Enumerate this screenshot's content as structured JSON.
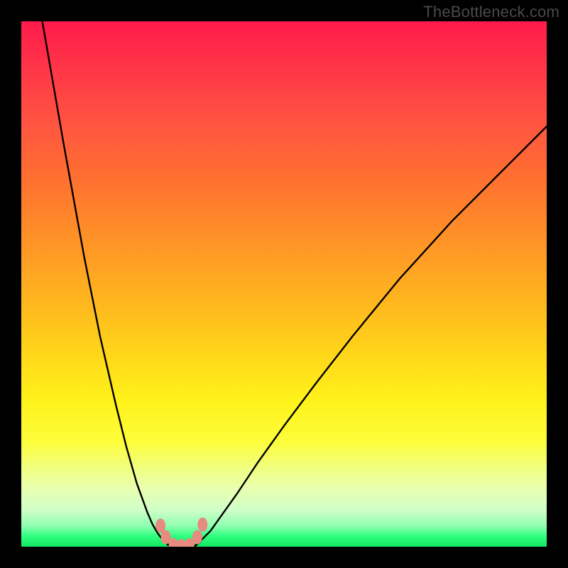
{
  "watermark": "TheBottleneck.com",
  "chart_data": {
    "type": "line",
    "title": "",
    "xlabel": "",
    "ylabel": "",
    "xlim": [
      0,
      100
    ],
    "ylim": [
      0,
      100
    ],
    "background_gradient_meaning": "red high to green low",
    "series": [
      {
        "name": "curve-left",
        "x": [
          4,
          8,
          12,
          15,
          18,
          20,
          22,
          24,
          25,
          26,
          27,
          28,
          29
        ],
        "y": [
          100,
          77,
          55,
          40,
          27,
          19,
          12,
          6.5,
          4.2,
          2.5,
          1.2,
          0.4,
          0
        ]
      },
      {
        "name": "curve-right",
        "x": [
          33,
          34,
          36,
          38,
          41,
          45,
          50,
          56,
          63,
          72,
          82,
          92,
          100
        ],
        "y": [
          0,
          1.0,
          3.0,
          5.8,
          10,
          16,
          23,
          31,
          40,
          51,
          62,
          72,
          80
        ]
      },
      {
        "name": "flat-bottom",
        "x": [
          27,
          28,
          29,
          30,
          31,
          32,
          33,
          34
        ],
        "y": [
          1.0,
          0.3,
          0,
          0,
          0,
          0,
          0.2,
          0.8
        ]
      }
    ],
    "markers": [
      {
        "name": "left-marker-upper",
        "x": 26.5,
        "y": 4.0
      },
      {
        "name": "left-marker-lower",
        "x": 27.5,
        "y": 1.8
      },
      {
        "name": "right-marker-upper",
        "x": 34.5,
        "y": 4.2
      },
      {
        "name": "right-marker-lower",
        "x": 33.5,
        "y": 1.8
      },
      {
        "name": "bottom-marker-1",
        "x": 29.0,
        "y": 0.3
      },
      {
        "name": "bottom-marker-2",
        "x": 30.5,
        "y": 0.1
      },
      {
        "name": "bottom-marker-3",
        "x": 32.0,
        "y": 0.3
      }
    ],
    "marker_color": "#e78a80"
  }
}
